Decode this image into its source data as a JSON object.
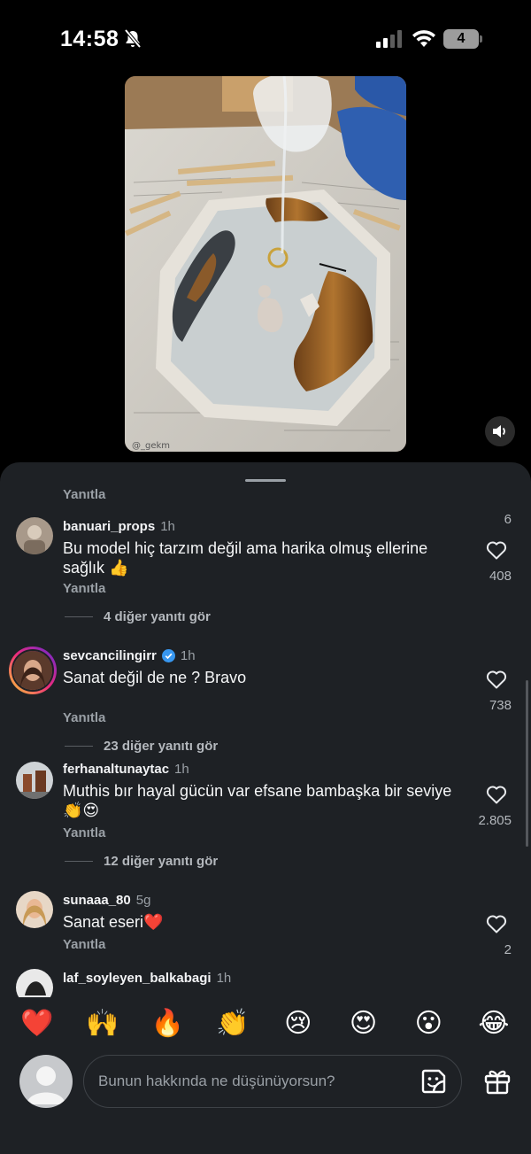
{
  "status_bar": {
    "time": "14:58",
    "battery": "4"
  },
  "video": {
    "watermark": "@_gekm"
  },
  "comments_sheet": {
    "top_partial": {
      "reply_label": "Yanıtla",
      "likes": "6"
    },
    "comments": [
      {
        "username": "banuari_props",
        "time": "1h",
        "text": "Bu model hiç tarzım değil ama harika olmuş ellerine sağlık 👍",
        "reply_label": "Yanıtla",
        "likes": "408",
        "more_replies": "4 diğer yanıtı gör"
      },
      {
        "username": "sevcancilingirr",
        "time": "1h",
        "text": "Sanat değil de ne ? Bravo",
        "reply_label": "Yanıtla",
        "likes": "738",
        "more_replies": "23 diğer yanıtı gör"
      },
      {
        "username": "ferhanaltunaytac",
        "time": "1h",
        "text": "Muthis bır hayal gücün var efsane bambaşka bir seviye 👏😍",
        "reply_label": "Yanıtla",
        "likes": "2.805",
        "more_replies": "12 diğer yanıtı gör"
      },
      {
        "username": "sunaaa_80",
        "time": "5g",
        "text": "Sanat eseri❤️",
        "reply_label": "Yanıtla",
        "likes": "2"
      },
      {
        "username": "laf_soyleyen_balkabagi",
        "time": "1h"
      }
    ]
  },
  "reactions": [
    "❤️",
    "🙌",
    "🔥",
    "👏",
    "😢",
    "😍",
    "😮",
    "😂"
  ],
  "composer": {
    "placeholder": "Bunun hakkında ne düşünüyorsun?"
  },
  "colors": {
    "sheet_bg": "#1e2125",
    "muted_text": "#9aa0a6",
    "accent_verified": "#3897f0"
  }
}
